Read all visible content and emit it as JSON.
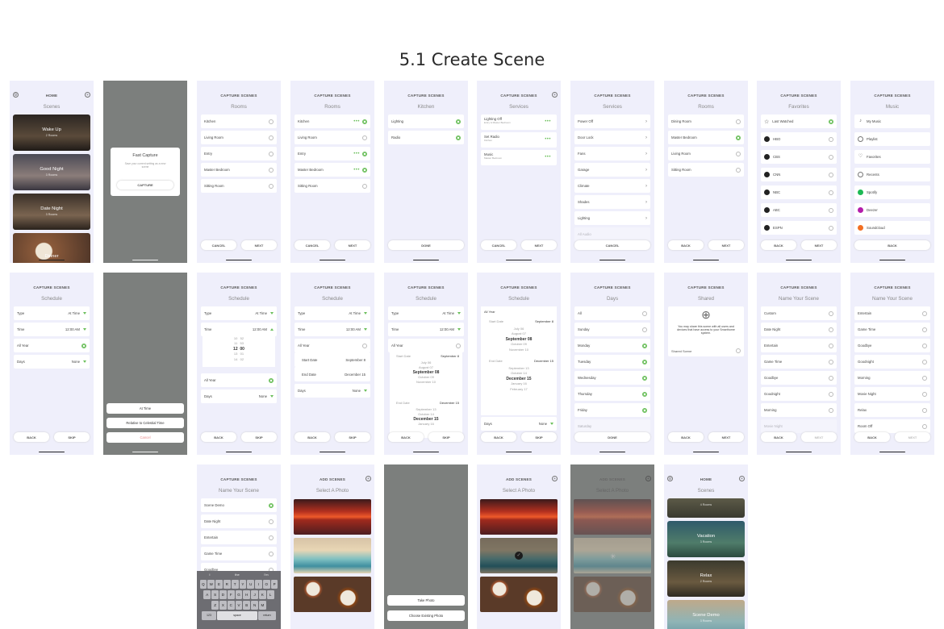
{
  "title": "5.1 Create Scene",
  "home": {
    "header": "HOME",
    "subtitle": "Scenes",
    "scenes": [
      {
        "name": "Wake Up",
        "sub": "2 Rooms"
      },
      {
        "name": "Good Night",
        "sub": "3 Rooms"
      },
      {
        "name": "Date Night",
        "sub": "3 Rooms"
      },
      {
        "name": "Dinner",
        "sub": ""
      }
    ]
  },
  "fast_capture": {
    "title": "Fast Capture",
    "body": "Save your current setting as a new scene",
    "button": "CAPTURE"
  },
  "rooms_a": {
    "header": "CAPTURE SCENES",
    "subtitle": "Rooms",
    "rows": [
      "Kitchen",
      "Living Room",
      "Entry",
      "Master Bedroom",
      "Sitting Room"
    ],
    "buttons": [
      "CANCEL",
      "NEXT"
    ]
  },
  "rooms_b": {
    "header": "CAPTURE SCENES",
    "subtitle": "Rooms",
    "rows": [
      "Kitchen",
      "Living Room",
      "Entry",
      "Master Bedroom",
      "Sitting Room"
    ],
    "buttons": [
      "CANCEL",
      "NEXT"
    ]
  },
  "kitchen": {
    "header": "CAPTURE SCENES",
    "subtitle": "Kitchen",
    "rows": [
      "Lighting",
      "Radio"
    ],
    "buttons": [
      "DONE"
    ]
  },
  "services_a": {
    "header": "CAPTURE SCENES",
    "subtitle": "Services",
    "rows": [
      {
        "name": "Lighting Off",
        "sub": "Entry & Master Bedroom"
      },
      {
        "name": "Set Radio",
        "sub": "Kitchen"
      },
      {
        "name": "Music",
        "sub": "Master Bedroom"
      }
    ],
    "buttons": [
      "CANCEL",
      "NEXT"
    ]
  },
  "services_b": {
    "header": "CAPTURE SCENES",
    "subtitle": "Services",
    "rows": [
      "Power Off",
      "Door Lock",
      "Fans",
      "Garage",
      "Climate",
      "Shades",
      "Lighting",
      "All Audio"
    ],
    "buttons": [
      "CANCEL"
    ]
  },
  "rooms_c": {
    "header": "CAPTURE SCENES",
    "subtitle": "Rooms",
    "rows": [
      "Dining Room",
      "Master Bedroom",
      "Living Room",
      "Sitting Room"
    ],
    "buttons": [
      "BACK",
      "NEXT"
    ]
  },
  "favorites": {
    "header": "CAPTURE SCENES",
    "subtitle": "Favorites",
    "rows": [
      "Last Watched",
      "HBO",
      "CBS",
      "CNN",
      "NBC",
      "ABC",
      "ESPN"
    ],
    "buttons": [
      "BACK",
      "NEXT"
    ]
  },
  "music": {
    "header": "CAPTURE SCENES",
    "subtitle": "Music",
    "rows": [
      "My Music",
      "Playlist",
      "Favorites",
      "Recents",
      "Spotify",
      "Deezer",
      "Soundcloud"
    ],
    "buttons": [
      "BACK"
    ]
  },
  "schedule_a": {
    "header": "CAPTURE SCENES",
    "subtitle": "Schedule",
    "rows": [
      {
        "name": "Type",
        "val": "At Time"
      },
      {
        "name": "Time",
        "val": "12:00 AM"
      },
      {
        "name": "All Year",
        "val": ""
      },
      {
        "name": "Days",
        "val": "None"
      }
    ],
    "buttons": [
      "BACK",
      "SKIP"
    ]
  },
  "type_sheet": {
    "options": [
      "At Time",
      "Relative to Celestial Time",
      "Cancel"
    ]
  },
  "schedule_b": {
    "header": "CAPTURE SCENES",
    "subtitle": "Schedule",
    "rows": [
      {
        "name": "Type",
        "val": "At Time"
      },
      {
        "name": "Time",
        "val": "12:00 AM"
      }
    ],
    "picker": [
      [
        "10",
        "52"
      ],
      [
        "11",
        "53"
      ],
      [
        "12",
        "00"
      ],
      [
        "13",
        "01"
      ],
      [
        "14",
        "02"
      ]
    ],
    "rows2": [
      {
        "name": "All Year",
        "val": ""
      },
      {
        "name": "Days",
        "val": "None"
      }
    ],
    "buttons": [
      "BACK",
      "SKIP"
    ]
  },
  "schedule_c": {
    "header": "CAPTURE SCENES",
    "subtitle": "Schedule",
    "rows": [
      {
        "name": "Type",
        "val": "At Time"
      },
      {
        "name": "Time",
        "val": "12:00 AM"
      },
      {
        "name": "All Year",
        "val": ""
      }
    ],
    "start": {
      "label": "Start Date",
      "val": "September 8"
    },
    "end": {
      "label": "End Date",
      "val": "December 15"
    },
    "days": {
      "name": "Days",
      "val": "None"
    },
    "buttons": [
      "BACK",
      "SKIP"
    ]
  },
  "schedule_d": {
    "header": "CAPTURE SCENES",
    "subtitle": "Schedule",
    "rows": [
      {
        "name": "Type",
        "val": "At Time"
      },
      {
        "name": "Time",
        "val": "12:00 AM"
      },
      {
        "name": "All Year",
        "val": ""
      }
    ],
    "start": {
      "label": "Start Date",
      "val": "September 8"
    },
    "picker1": [
      "July 06",
      "August 07",
      "September 08",
      "October 09",
      "November 10"
    ],
    "end": {
      "label": "End Date",
      "val": "December 15"
    },
    "picker2": [
      "September 13",
      "October 14",
      "December 15",
      "January 16"
    ],
    "buttons": [
      "BACK",
      "SKIP"
    ]
  },
  "schedule_e": {
    "header": "CAPTURE SCENES",
    "subtitle": "Schedule",
    "all_year": "All Year",
    "start": {
      "label": "Start Date",
      "val": "September 8"
    },
    "picker1": [
      "July 06",
      "August 07",
      "September 08",
      "October 09",
      "November 10"
    ],
    "end": {
      "label": "End Date",
      "val": "December 15"
    },
    "picker2": [
      "September 13",
      "October 14",
      "December 15",
      "January 16",
      "February 17"
    ],
    "days": {
      "name": "Days",
      "val": "None"
    },
    "buttons": [
      "BACK",
      "SKIP"
    ]
  },
  "days": {
    "header": "CAPTURE SCENES",
    "subtitle": "Days",
    "rows": [
      "All",
      "Sunday",
      "Monday",
      "Tuesday",
      "Wednesday",
      "Thursday",
      "Friday",
      "Saturday"
    ],
    "buttons": [
      "DONE"
    ]
  },
  "shared": {
    "header": "CAPTURE SCENES",
    "subtitle": "Shared",
    "body": "You may share this scene with all users and devices that have access to your Smarthome system.",
    "label": "Shared Scene",
    "buttons": [
      "BACK",
      "NEXT"
    ]
  },
  "name_a": {
    "header": "CAPTURE SCENES",
    "subtitle": "Name Your Scene",
    "rows": [
      "Custom",
      "Date Night",
      "Entertain",
      "Game Time",
      "Goodbye",
      "Goodnight",
      "Morning",
      "Movie Night"
    ],
    "buttons": [
      "BACK",
      "NEXT"
    ]
  },
  "name_b": {
    "header": "CAPTURE SCENES",
    "subtitle": "Name Your Scene",
    "rows": [
      "Entertain",
      "Game Time",
      "Goodbye",
      "Goodnight",
      "Morning",
      "Movie Night",
      "Relax",
      "Room Off"
    ],
    "buttons": [
      "BACK",
      "NEXT"
    ]
  },
  "name_c": {
    "header": "CAPTURE SCENES",
    "subtitle": "Name Your Scene",
    "rows": [
      "Scene Demo",
      "Date Night",
      "Entertain",
      "Game Time",
      "Goodbye"
    ],
    "suggest": [
      "I",
      "the",
      "I'm"
    ],
    "keys": [
      [
        "Q",
        "W",
        "E",
        "R",
        "T",
        "Y",
        "U",
        "I",
        "O",
        "P"
      ],
      [
        "A",
        "S",
        "D",
        "F",
        "G",
        "H",
        "J",
        "K",
        "L"
      ],
      [
        "Z",
        "X",
        "C",
        "V",
        "B",
        "N",
        "M"
      ]
    ],
    "space": "space",
    "num": "123",
    "ret": "return"
  },
  "add_a": {
    "header": "ADD SCENES",
    "subtitle": "Select A Photo"
  },
  "photo_sheet": {
    "options": [
      "Take Photo",
      "Choose Existing Photo"
    ]
  },
  "add_b": {
    "header": "ADD SCENES",
    "subtitle": "Select A Photo"
  },
  "add_c": {
    "header": "ADD SCENES",
    "subtitle": "Select A Photo"
  },
  "home_b": {
    "header": "HOME",
    "subtitle": "Scenes",
    "scenes": [
      {
        "name": "",
        "sub": "4 Rooms"
      },
      {
        "name": "Vacation",
        "sub": "3 Rooms"
      },
      {
        "name": "Relax",
        "sub": "2 Rooms"
      },
      {
        "name": "Scene Demo",
        "sub": "3 Rooms"
      }
    ]
  }
}
